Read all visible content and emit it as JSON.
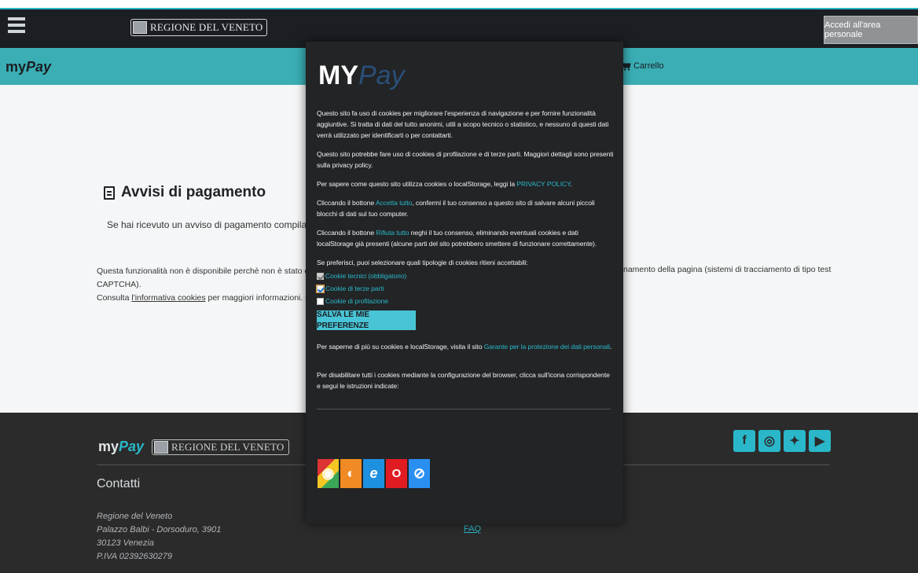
{
  "header": {
    "region_name": "REGIONE DEL VENETO",
    "login_label": "Accedi all'area personale"
  },
  "nav": {
    "logo_prefix": "my",
    "logo_suffix": "Pay",
    "cart_label": "Carrello"
  },
  "main": {
    "title": "Avvisi di pagamento",
    "subtitle": "Se hai ricevuto un avviso di pagamento compila il segu",
    "notice_line1_left": "Questa funzionalità non è disponibile perchè non è stato conse",
    "notice_line1_right": "namento della pagina (sistemi di tracciamento di tipo test",
    "notice_line2": "CAPTCHA).",
    "notice_line3_prefix": "Consulta ",
    "notice_link": "l'informativa cookies",
    "notice_line3_suffix": " per maggiori informazioni. Clicca"
  },
  "footer": {
    "logo_prefix": "my",
    "logo_suffix": "Pay",
    "region_name": "REGIONE DEL VENETO",
    "contacts_title": "Contatti",
    "address": [
      "Regione del Veneto",
      "Palazzo Balbi - Dorsoduro, 3901",
      "30123 Venezia",
      "P.IVA 02392630279"
    ],
    "faq_label": "FAQ",
    "socials": [
      "facebook-icon",
      "instagram-icon",
      "twitter-icon",
      "youtube-icon"
    ]
  },
  "modal": {
    "logo_prefix": "MY",
    "logo_suffix": "Pay",
    "p1": "Questo sito fa uso di cookies per migliorare l'esperienza di navigazione e per fornire funzionalità aggiuntive. Si tratta di dati del tutto anonimi, utili a scopo tecnico o statistico, e nessuno di questi dati verrà utilizzato per identificarti o per contattarti.",
    "p2": "Questo sito potrebbe fare uso di cookies di profilazione e di terze parti. Maggiori dettagli sono presenti sulla privacy policy.",
    "p3_prefix": "Per sapere come questo sito utilizza cookies o localStorage, leggi la ",
    "p3_link": "PRIVACY POLICY",
    "p3_suffix": ".",
    "p4_prefix": "Cliccando il bottone ",
    "p4_link": "Accetta tutto",
    "p4_suffix": ", confermi il tuo consenso a questo sito di salvare alcuni piccoli blocchi di dati sul tuo computer.",
    "p5_prefix": "Cliccando il bottone ",
    "p5_link": "Rifiuta tutto",
    "p5_suffix": " neghi il tuo consenso, eliminando eventuali cookies e dati localStorage già presenti (alcune parti del sito potrebbero smettere di funzionare correttamente).",
    "choose_label": "Se preferisci, puoi selezionare quali tipologie di cookies ritieni accettabili:",
    "options": [
      {
        "label": "Cookie tecnici (obbligatorio)",
        "checked": true,
        "disabled": true
      },
      {
        "label": "Cookie di terze parti",
        "checked": true,
        "disabled": false
      },
      {
        "label": "Cookie di profilazione",
        "checked": false,
        "disabled": false
      }
    ],
    "save_label": "SALVA LE MIE PREFERENZE",
    "p6_prefix": "Per saperne di più su cookies e localStorage, visita il sito ",
    "p6_link": "Garante per la protezione dei dati personali",
    "p6_suffix": ".",
    "p7": "Per disabilitare tutti i cookies mediante la configurazione del browser, clicca sull'icona corrispondente e segui le istruzioni indicate:",
    "browsers": [
      "chrome-icon",
      "firefox-icon",
      "internet-explorer-icon",
      "opera-icon",
      "safari-icon"
    ]
  }
}
